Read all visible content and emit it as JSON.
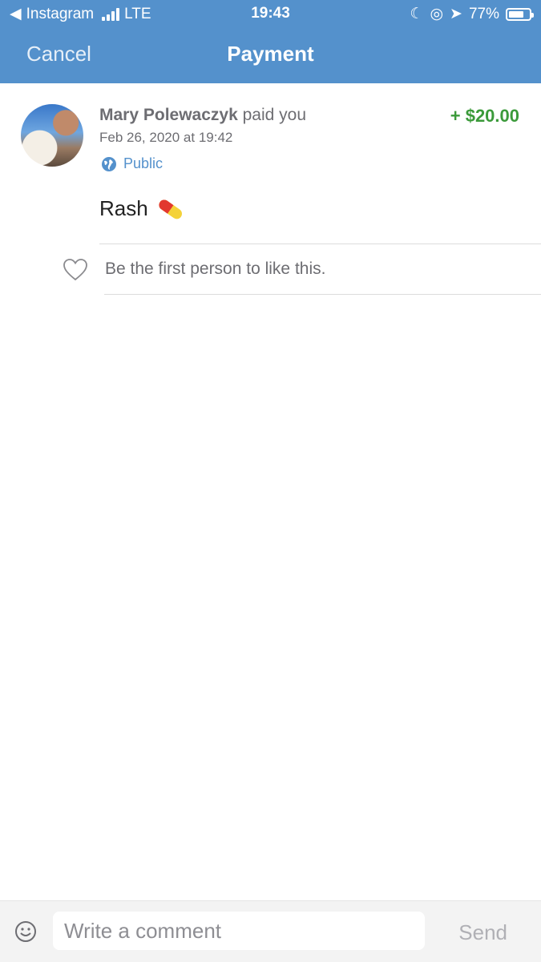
{
  "status_bar": {
    "back_app": "Instagram",
    "carrier": "LTE",
    "time": "19:43",
    "battery": "77%",
    "battery_level": 0.77
  },
  "header": {
    "cancel_label": "Cancel",
    "title": "Payment"
  },
  "transaction": {
    "payer_name": "Mary Polewaczyk",
    "action_text": "paid you",
    "amount": "+ $20.00",
    "date": "Feb 26, 2020 at 19:42",
    "privacy": "Public",
    "note": "Rash",
    "note_emoji": "pill"
  },
  "likes": {
    "text": "Be the first person to like this."
  },
  "composer": {
    "placeholder": "Write a comment",
    "send_label": "Send"
  },
  "colors": {
    "header_blue": "#5491cc",
    "amount_green": "#3b9a3a",
    "link_blue": "#5491cc"
  }
}
